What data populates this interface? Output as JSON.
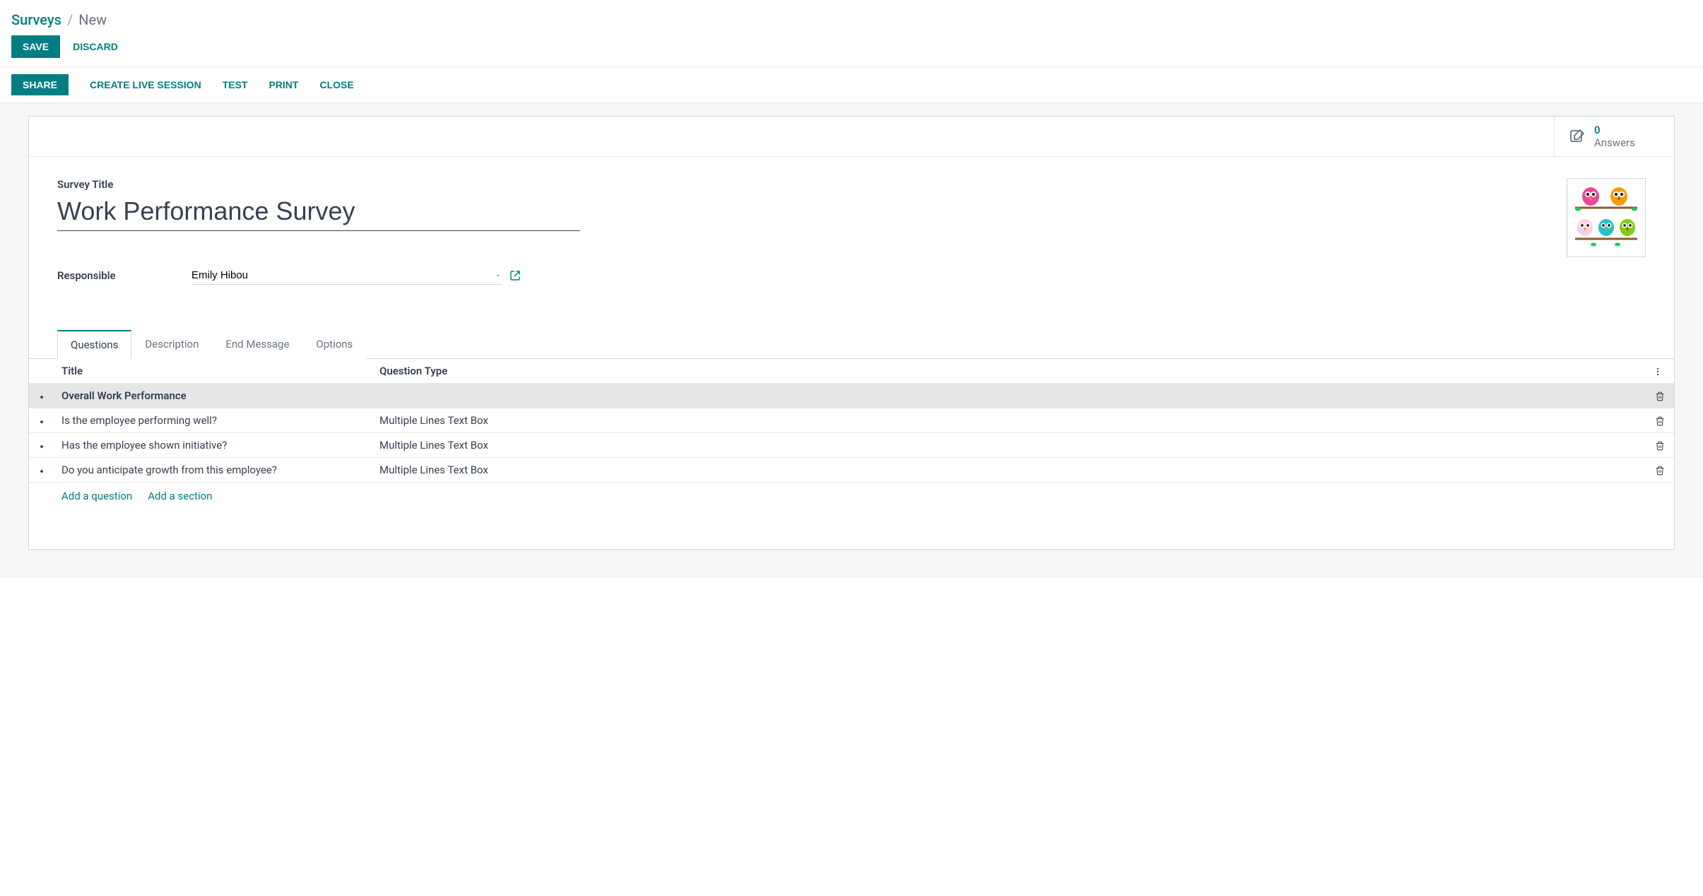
{
  "breadcrumb": {
    "root": "Surveys",
    "sep": "/",
    "current": "New"
  },
  "buttons": {
    "save": "SAVE",
    "discard": "DISCARD",
    "share": "SHARE",
    "create_live": "CREATE LIVE SESSION",
    "test": "TEST",
    "print": "PRINT",
    "close": "CLOSE"
  },
  "stats": {
    "answers_count": "0",
    "answers_label": "Answers"
  },
  "form": {
    "title_label": "Survey Title",
    "title_value": "Work Performance Survey",
    "responsible_label": "Responsible",
    "responsible_value": "Emily Hibou"
  },
  "tabs": {
    "questions": "Questions",
    "description": "Description",
    "end_message": "End Message",
    "options": "Options"
  },
  "table": {
    "col_title": "Title",
    "col_type": "Question Type",
    "rows": [
      {
        "section": true,
        "title": "Overall Work Performance",
        "type": ""
      },
      {
        "section": false,
        "title": "Is the employee performing well?",
        "type": "Multiple Lines Text Box"
      },
      {
        "section": false,
        "title": "Has the employee shown initiative?",
        "type": "Multiple Lines Text Box"
      },
      {
        "section": false,
        "title": "Do you anticipate growth from this employee?",
        "type": "Multiple Lines Text Box"
      }
    ]
  },
  "add": {
    "question": "Add a question",
    "section": "Add a section"
  }
}
